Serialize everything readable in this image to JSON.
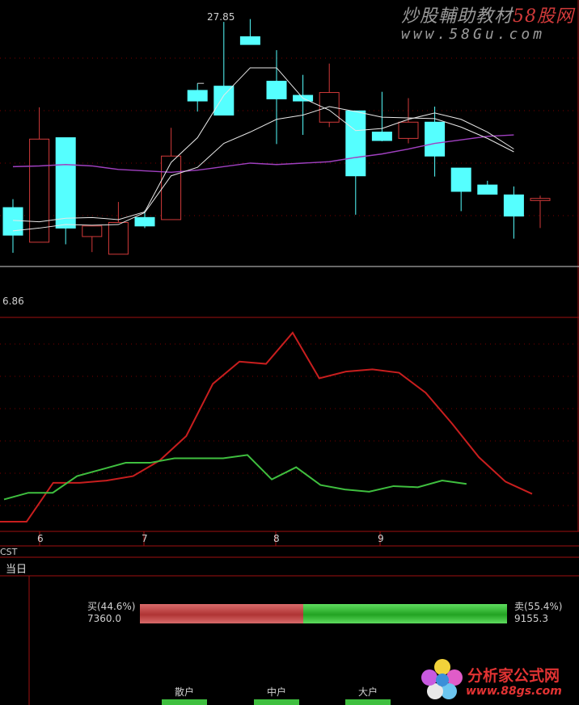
{
  "watermark": {
    "title_prefix": "炒股輔助教材",
    "title_brand": "58股网",
    "url": "www.58Gu.com"
  },
  "price_panel": {
    "high_label": "27.85",
    "low_label": "6.86"
  },
  "x_axis": {
    "ticks": [
      "6",
      "7",
      "8",
      "9"
    ]
  },
  "indicator_tab": "CST",
  "bottom_panel": {
    "today_label": "当日",
    "buy_label": "买(44.6%)",
    "buy_value": "7360.0",
    "sell_label": "卖(55.4%)",
    "sell_value": "9155.3",
    "buy_pct": 44.6,
    "sell_pct": 55.4,
    "categories": [
      "散户",
      "中户",
      "大户"
    ]
  },
  "logo": {
    "text": "分析家公式网",
    "url": "www.88gs.com"
  },
  "colors": {
    "up": "#d23a3a",
    "down": "#55ffff",
    "ma_white": "#e8e8e8",
    "ma_purple": "#a040c0",
    "ind_red": "#c81e1e",
    "ind_green": "#3fbf3f",
    "grid": "#7a0000"
  },
  "chart_data": [
    {
      "type": "candlestick",
      "title": "",
      "high_marker": 27.85,
      "low_marker": 6.86,
      "candles": [
        {
          "o": 15.2,
          "c": 11.3,
          "h": 16.4,
          "l": 8.8
        },
        {
          "o": 10.3,
          "c": 24.9,
          "h": 29.4,
          "l": 10.3
        },
        {
          "o": 25.1,
          "c": 12.3,
          "h": 25.1,
          "l": 10.0
        },
        {
          "o": 11.1,
          "c": 12.6,
          "h": 12.6,
          "l": 8.9
        },
        {
          "o": 8.6,
          "c": 13.1,
          "h": 16.0,
          "l": 8.6
        },
        {
          "o": 13.8,
          "c": 12.6,
          "h": 14.8,
          "l": 12.3
        },
        {
          "o": 13.5,
          "c": 22.5,
          "h": 26.5,
          "l": 13.5
        },
        {
          "o": 31.8,
          "c": 30.3,
          "h": 32.8,
          "l": 28.8
        },
        {
          "o": 32.4,
          "c": 28.3,
          "h": 41.5,
          "l": 28.3
        },
        {
          "o": 39.4,
          "c": 38.3,
          "h": 41.9,
          "l": 38.3
        },
        {
          "o": 33.1,
          "c": 30.6,
          "h": 37.5,
          "l": 24.2
        },
        {
          "o": 31.1,
          "c": 30.3,
          "h": 34.0,
          "l": 25.5
        },
        {
          "o": 27.3,
          "c": 31.5,
          "h": 35.6,
          "l": 26.6
        },
        {
          "o": 28.9,
          "c": 19.7,
          "h": 28.9,
          "l": 14.2
        },
        {
          "o": 25.9,
          "c": 24.7,
          "h": 31.6,
          "l": 24.6
        },
        {
          "o": 25.0,
          "c": 27.3,
          "h": 30.7,
          "l": 24.3
        },
        {
          "o": 27.3,
          "c": 22.5,
          "h": 29.5,
          "l": 19.6
        },
        {
          "o": 20.8,
          "c": 17.5,
          "h": 20.8,
          "l": 14.7
        },
        {
          "o": 18.4,
          "c": 17.1,
          "h": 19.0,
          "l": 17.1
        },
        {
          "o": 17.0,
          "c": 14.0,
          "h": 18.2,
          "l": 10.8
        },
        {
          "o": 16.2,
          "c": 16.5,
          "h": 16.9,
          "l": 12.3
        }
      ],
      "ma_short": [
        13.4,
        13.2,
        13.7,
        13.8,
        13.5,
        14.6,
        21.6,
        25.1,
        31.1,
        35.0,
        35.0,
        30.7,
        29.0,
        26.1,
        26.4,
        27.7,
        28.6,
        27.7,
        25.9,
        23.5
      ],
      "ma_mid": [
        11.9,
        12.3,
        12.8,
        12.7,
        12.8,
        14.5,
        19.7,
        20.9,
        24.3,
        25.9,
        27.7,
        28.3,
        29.5,
        28.8,
        28.0,
        27.9,
        27.8,
        26.6,
        25.0,
        23.1
      ],
      "ma_long": [
        21.0,
        21.1,
        21.3,
        21.1,
        20.6,
        20.4,
        20.2,
        20.5,
        21.0,
        21.5,
        21.3,
        21.5,
        21.7,
        22.3,
        22.8,
        23.5,
        24.3,
        24.8,
        25.3,
        25.5
      ]
    },
    {
      "type": "line",
      "title": "CST",
      "series": [
        {
          "color": "red",
          "values": [
            0.0,
            0.0,
            17.5,
            17.5,
            18.5,
            20.5,
            27.5,
            38.5,
            62.0,
            72.0,
            71.0,
            85.0,
            64.5,
            67.5,
            68.5,
            67.0,
            58.0,
            44.0,
            29.0,
            18.0,
            12.5
          ]
        },
        {
          "color": "green",
          "values": [
            10.0,
            13.0,
            13.0,
            20.5,
            23.5,
            26.5,
            26.5,
            28.5,
            28.5,
            28.5,
            30.0,
            19.0,
            24.5,
            16.5,
            14.5,
            13.5,
            16.0,
            15.5,
            18.5,
            17.0
          ]
        }
      ]
    }
  ]
}
